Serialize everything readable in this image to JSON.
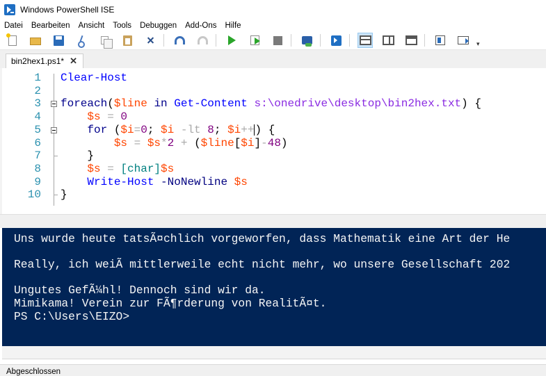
{
  "window": {
    "title": "Windows PowerShell ISE"
  },
  "menu": [
    "Datei",
    "Bearbeiten",
    "Ansicht",
    "Tools",
    "Debuggen",
    "Add-Ons",
    "Hilfe"
  ],
  "toolbar": {
    "icons": [
      "new-script-icon",
      "open-icon",
      "save-icon",
      "cut-icon",
      "copy-icon",
      "paste-icon",
      "clear-console-icon",
      "undo-icon",
      "redo-icon",
      "run-script-icon",
      "run-selection-icon",
      "stop-icon",
      "remote-powershell-icon",
      "powershell-console-icon",
      "script-pane-top-icon",
      "script-pane-right-icon",
      "script-pane-maximized-icon",
      "show-script-pane-icon",
      "hide-command-add-on-icon"
    ]
  },
  "tab": {
    "label": "bin2hex1.ps1*",
    "close": "✕"
  },
  "editor": {
    "lines": [
      {
        "n": "1",
        "tokens": [
          {
            "t": "Clear-Host",
            "c": "k-cmd"
          }
        ]
      },
      {
        "n": "2",
        "tokens": []
      },
      {
        "n": "3",
        "tokens": [
          {
            "t": "foreach",
            "c": "k-key"
          },
          {
            "t": "(",
            "c": "k-plain"
          },
          {
            "t": "$line",
            "c": "k-var"
          },
          {
            "t": " ",
            "c": "k-plain"
          },
          {
            "t": "in",
            "c": "k-key"
          },
          {
            "t": " ",
            "c": "k-plain"
          },
          {
            "t": "Get-Content",
            "c": "k-cmd"
          },
          {
            "t": " ",
            "c": "k-plain"
          },
          {
            "t": "s:\\onedrive\\desktop\\bin2hex.txt",
            "c": "k-str"
          },
          {
            "t": ") {",
            "c": "k-plain"
          }
        ]
      },
      {
        "n": "4",
        "tokens": [
          {
            "t": "    ",
            "c": "k-plain"
          },
          {
            "t": "$s",
            "c": "k-var"
          },
          {
            "t": " = ",
            "c": "k-op"
          },
          {
            "t": "0",
            "c": "k-num"
          }
        ]
      },
      {
        "n": "5",
        "tokens": [
          {
            "t": "    ",
            "c": "k-plain"
          },
          {
            "t": "for",
            "c": "k-key"
          },
          {
            "t": " (",
            "c": "k-plain"
          },
          {
            "t": "$i",
            "c": "k-var"
          },
          {
            "t": "=",
            "c": "k-op"
          },
          {
            "t": "0",
            "c": "k-num"
          },
          {
            "t": "; ",
            "c": "k-plain"
          },
          {
            "t": "$i",
            "c": "k-var"
          },
          {
            "t": " -lt ",
            "c": "k-op"
          },
          {
            "t": "8",
            "c": "k-num"
          },
          {
            "t": "; ",
            "c": "k-plain"
          },
          {
            "t": "$i",
            "c": "k-var"
          },
          {
            "t": "++",
            "c": "k-op"
          },
          {
            "t": ") {",
            "c": "k-plain"
          }
        ]
      },
      {
        "n": "6",
        "tokens": [
          {
            "t": "        ",
            "c": "k-plain"
          },
          {
            "t": "$s",
            "c": "k-var"
          },
          {
            "t": " = ",
            "c": "k-op"
          },
          {
            "t": "$s",
            "c": "k-var"
          },
          {
            "t": "*",
            "c": "k-op"
          },
          {
            "t": "2",
            "c": "k-num"
          },
          {
            "t": " + ",
            "c": "k-op"
          },
          {
            "t": "(",
            "c": "k-plain"
          },
          {
            "t": "$line",
            "c": "k-var"
          },
          {
            "t": "[",
            "c": "k-plain"
          },
          {
            "t": "$i",
            "c": "k-var"
          },
          {
            "t": "]",
            "c": "k-plain"
          },
          {
            "t": "-",
            "c": "k-op"
          },
          {
            "t": "48",
            "c": "k-num"
          },
          {
            "t": ")",
            "c": "k-plain"
          }
        ]
      },
      {
        "n": "7",
        "tokens": [
          {
            "t": "    }",
            "c": "k-plain"
          }
        ]
      },
      {
        "n": "8",
        "tokens": [
          {
            "t": "    ",
            "c": "k-plain"
          },
          {
            "t": "$s",
            "c": "k-var"
          },
          {
            "t": " = ",
            "c": "k-op"
          },
          {
            "t": "[char]",
            "c": "k-type"
          },
          {
            "t": "$s",
            "c": "k-var"
          }
        ]
      },
      {
        "n": "9",
        "tokens": [
          {
            "t": "    ",
            "c": "k-plain"
          },
          {
            "t": "Write-Host",
            "c": "k-cmd"
          },
          {
            "t": " ",
            "c": "k-plain"
          },
          {
            "t": "-NoNewline",
            "c": "k-param"
          },
          {
            "t": " ",
            "c": "k-plain"
          },
          {
            "t": "$s",
            "c": "k-var"
          }
        ]
      },
      {
        "n": "10",
        "tokens": [
          {
            "t": "}",
            "c": "k-plain"
          }
        ]
      }
    ]
  },
  "console": {
    "lines": [
      "Uns wurde heute tatsÃ¤chlich vorgeworfen, dass Mathematik eine Art der He",
      "",
      "Really, ich weiÃ mittlerweile echt nicht mehr, wo unsere Gesellschaft 202",
      "",
      "Ungutes GefÃ¼hl! Dennoch sind wir da.",
      "Mimikama! Verein zur FÃ¶rderung von RealitÃ¤t.",
      "PS C:\\Users\\EIZO>"
    ]
  },
  "status": {
    "text": "Abgeschlossen"
  }
}
